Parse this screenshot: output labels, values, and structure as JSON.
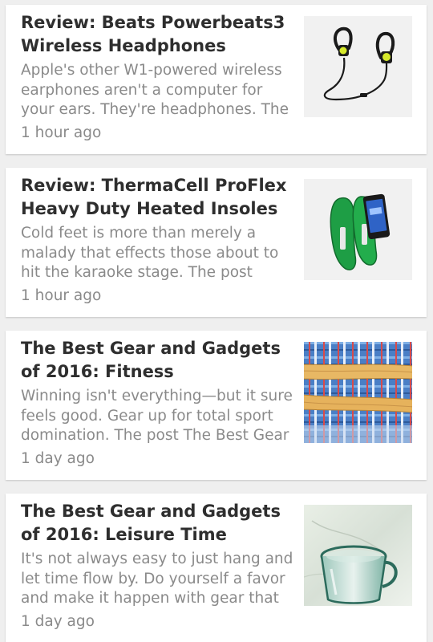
{
  "articles": [
    {
      "title": "Review: Beats Powerbeats3 Wireless Headphones",
      "excerpt": "Apple's other W1-powered wireless earphones aren't a computer for your ears. They're headphones. The",
      "time": "1 hour ago",
      "thumbnail": "wireless-earphones-image"
    },
    {
      "title": "Review: ThermaCell ProFlex Heavy Duty Heated Insoles",
      "excerpt": "Cold feet is more than merely a malady that effects those about to hit the karaoke stage. The post",
      "time": "1 hour ago",
      "thumbnail": "heated-insoles-image"
    },
    {
      "title": "The Best Gear and Gadgets of 2016: Fitness",
      "excerpt": "Winning isn't everything—but it sure feels good. Gear up for total sport domination. The post The Best Gear",
      "time": "1 day ago",
      "thumbnail": "fitness-gear-image"
    },
    {
      "title": "The Best Gear and Gadgets of 2016: Leisure Time",
      "excerpt": "It's not always easy to just hang and let time flow by. Do yourself a favor and make it happen with gear that",
      "time": "1 day ago",
      "thumbnail": "leisure-glass-image"
    }
  ],
  "colors": {
    "background": "#efefef",
    "card": "#ffffff",
    "title": "#2e2e2e",
    "secondary_text": "#8a8a8a"
  }
}
